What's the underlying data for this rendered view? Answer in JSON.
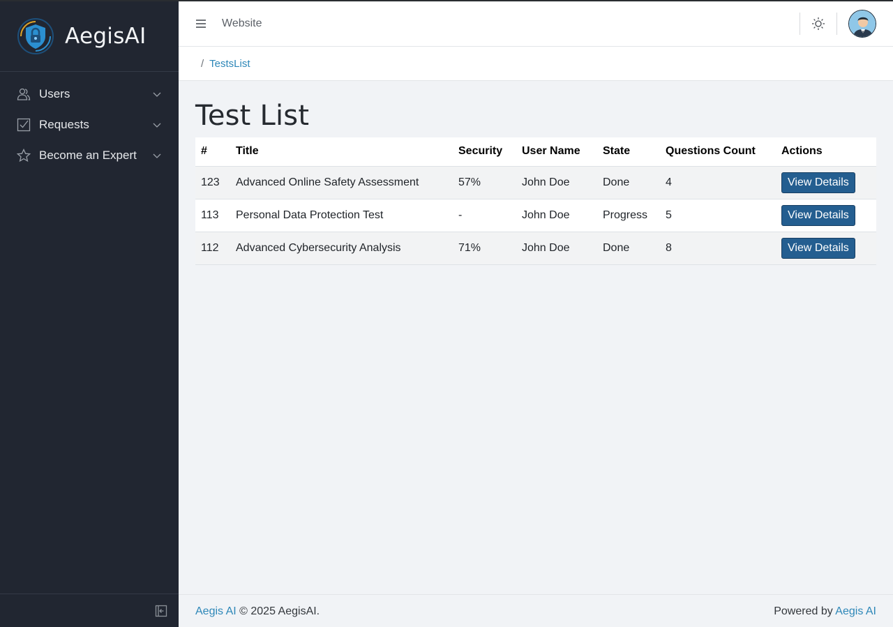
{
  "brand": {
    "name": "AegisAI",
    "logo_icon": "shield-lock-icon"
  },
  "sidebar": {
    "items": [
      {
        "label": "Users",
        "icon": "users-icon"
      },
      {
        "label": "Requests",
        "icon": "checkbox-icon"
      },
      {
        "label": "Become an Expert",
        "icon": "star-icon"
      }
    ],
    "collapse_icon": "sidebar-collapse-icon"
  },
  "header": {
    "website_link": "Website",
    "theme_icon": "sun-icon",
    "avatar_icon": "user-avatar-icon"
  },
  "breadcrumb": {
    "separator": "/",
    "current": "TestsList"
  },
  "page": {
    "title": "Test List"
  },
  "table": {
    "headers": [
      "#",
      "Title",
      "Security",
      "User Name",
      "State",
      "Questions Count",
      "Actions"
    ],
    "rows": [
      {
        "id": "123",
        "title": "Advanced Online Safety Assessment",
        "security": "57%",
        "user": "John Doe",
        "state": "Done",
        "questions": "4",
        "action": "View Details"
      },
      {
        "id": "113",
        "title": "Personal Data Protection Test",
        "security": "-",
        "user": "John Doe",
        "state": "Progress",
        "questions": "5",
        "action": "View Details"
      },
      {
        "id": "112",
        "title": "Advanced Cybersecurity Analysis",
        "security": "71%",
        "user": "John Doe",
        "state": "Done",
        "questions": "8",
        "action": "View Details"
      }
    ]
  },
  "footer": {
    "left_link": "Aegis AI",
    "left_text": " © 2025 AegisAI.",
    "right_text": "Powered by ",
    "right_link": "Aegis AI"
  },
  "colors": {
    "sidebar_bg": "#212631",
    "accent_link": "#2d87b8",
    "button_bg": "#245e90"
  }
}
